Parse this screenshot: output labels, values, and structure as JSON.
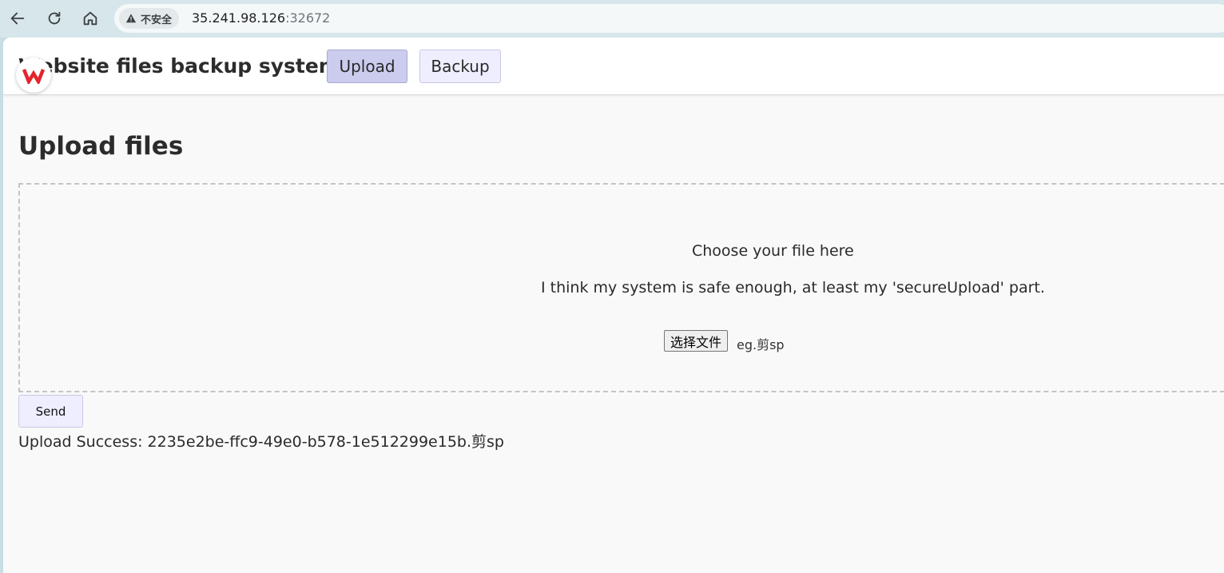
{
  "browser": {
    "security_label": "不安全",
    "url_host": "35.241.98.126",
    "url_port": ":32672"
  },
  "header": {
    "site_title": "Website files backup system",
    "tabs": [
      {
        "label": "Upload",
        "active": true
      },
      {
        "label": "Backup",
        "active": false
      }
    ]
  },
  "main": {
    "heading": "Upload files",
    "drop_zone": {
      "title": "Choose your file here",
      "note": "I think my system is safe enough, at least my 'secureUpload' part.",
      "choose_button_label": "选择文件",
      "selected_file_name": "eg.剪sp"
    },
    "send_label": "Send",
    "result_text": "Upload Success: 2235e2be-ffc9-49e0-b578-1e512299e15b.剪sp"
  },
  "colors": {
    "active_tab_bg": "#ccccee",
    "tab_bg": "#eeeeff",
    "page_bg": "#f9f9f9",
    "wps_red": "#e3242b"
  }
}
